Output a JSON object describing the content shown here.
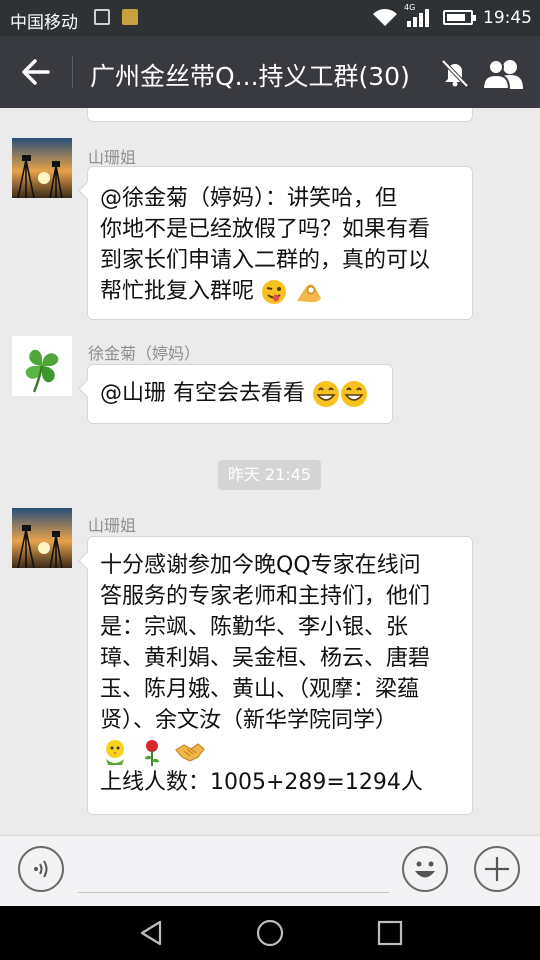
{
  "status_bar": {
    "carrier": "中国移动",
    "network": "4G",
    "time": "19:45",
    "battery_level": 0.8
  },
  "header": {
    "title": "广州金丝带Q...持义工群(30)"
  },
  "messages": [
    {
      "sender": "山珊姐",
      "lines": [
        "@徐金菊（婷妈）：讲笑哈，但",
        "你地不是已经放假了吗？如果有看",
        "到家长们申请入二群的，真的可以",
        "帮忙批复入群呢"
      ],
      "emoji_icons": [
        "winking-tongue-emoji-icon",
        "ok-hand-emoji-icon"
      ]
    },
    {
      "sender": "徐金菊（婷妈）",
      "lines": [
        "@山珊 有空会去看看"
      ],
      "emoji_icons": [
        "grinning-emoji-icon",
        "grinning-emoji-icon"
      ]
    },
    {
      "sender": "山珊姐",
      "lines": [
        "十分感谢参加今晚QQ专家在线问",
        "答服务的专家老师和主持们，他们",
        "是：宗飒、陈勤华、李小银、张",
        "璋、黄利娟、吴金桓、杨云、唐碧",
        "玉、陈月娥、黄山、（观摩：梁蕴",
        "贤）、余文汝（新华学院同学）"
      ],
      "emoji_icons": [
        "chick-emoji-icon",
        "rose-emoji-icon",
        "handshake-emoji-icon"
      ],
      "footer_line": "上线人数：1005+289=1294人"
    }
  ],
  "time_separator": "昨天 21:45"
}
